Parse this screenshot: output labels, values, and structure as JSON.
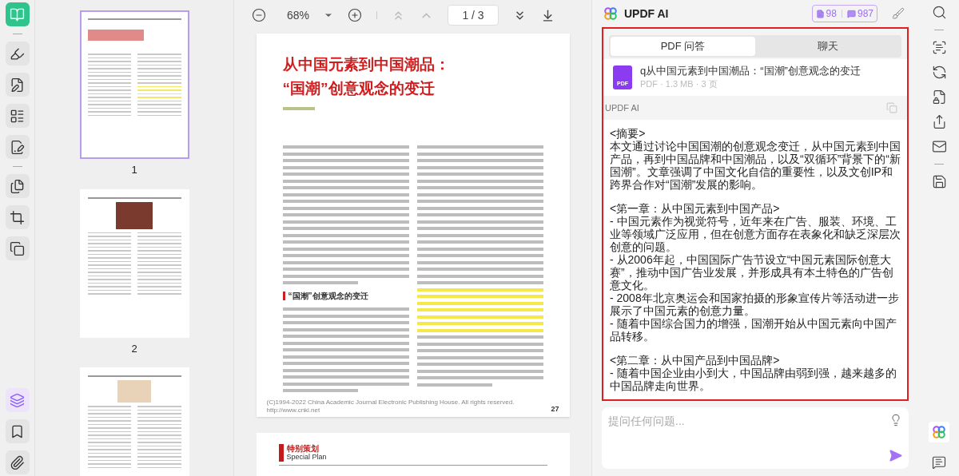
{
  "left_toolbar": {
    "top": [
      {
        "kind": "reader",
        "selected": true
      }
    ],
    "tools": [
      {
        "kind": "comment",
        "selected": false
      },
      {
        "kind": "edit",
        "selected": false
      },
      {
        "kind": "organize",
        "selected": false
      },
      {
        "kind": "fill",
        "selected": false
      }
    ],
    "pages": [
      {
        "kind": "pages",
        "selected": false
      },
      {
        "kind": "crop",
        "selected": false
      },
      {
        "kind": "compress",
        "selected": false
      }
    ],
    "bottom": [
      {
        "kind": "layers",
        "selected": true
      },
      {
        "kind": "bookmark",
        "selected": false
      },
      {
        "kind": "attachment",
        "selected": false
      }
    ]
  },
  "thumbnails": [
    {
      "label": "1",
      "selected": true,
      "kind": "title"
    },
    {
      "label": "2",
      "selected": false,
      "kind": "photo"
    },
    {
      "selected": false,
      "kind": "illustration"
    }
  ],
  "viewer_toolbar": {
    "zoom": "68%",
    "page": "1 / 3",
    "first_disabled": true,
    "prev_disabled": true
  },
  "document": {
    "title_lines": [
      "从中国元素到中国潮品：",
      "“国潮”创意观念的变迁"
    ],
    "section_heading": "“国潮”创意观念的变迁",
    "footer": "(C)1994-2022 China Academic Journal Electronic Publishing House. All rights reserved.    http://www.cnki.net",
    "page_number": "27",
    "next_page_header": "特别策划",
    "next_page_subheader": "Special Plan"
  },
  "ai_panel": {
    "title": "UPDF AI",
    "credits": [
      {
        "kind": "document",
        "value": "98"
      },
      {
        "kind": "chat",
        "value": "987"
      }
    ],
    "tabs": [
      {
        "label": "PDF 问答",
        "selected": true
      },
      {
        "label": "聊天",
        "selected": false
      }
    ],
    "file": {
      "name": "q从中国元素到中国潮品：“国潮”创意观念的变迁",
      "meta": "PDF · 1.3 MB · 3 页",
      "icon_text": "PDF"
    },
    "answer_label": "UPDF AI",
    "answer": [
      {
        "heading": "<摘要>",
        "lines": [
          "本文通过讨论中国国潮的创意观念变迁，从中国元素到中国产品，再到中国品牌和中国潮品，以及“双循环”背景下的“新国潮”。文章强调了中国文化自信的重要性，以及文创IP和跨界合作对“国潮”发展的影响。"
        ]
      },
      {
        "heading": "<第一章：从中国元素到中国产品>",
        "lines": [
          "- 中国元素作为视觉符号，近年来在广告、服装、环境、工业等领域广泛应用，但在创意方面存在表象化和缺乏深层次创意的问题。",
          "- 从2006年起，中国国际广告节设立“中国元素国际创意大赛”，推动中国广告业发展，并形成具有本土特色的广告创意文化。",
          "- 2008年北京奥运会和国家拍摄的形象宣传片等活动进一步展示了中国元素的创意力量。",
          "- 随着中国综合国力的增强，国潮开始从中国元素向中国产品转移。"
        ]
      },
      {
        "heading": "<第二章：从中国产品到中国品牌>",
        "lines": [
          "- 随着中国企业由小到大，中国品牌由弱到强，越来越多的中国品牌走向世界。"
        ]
      }
    ],
    "input": {
      "placeholder": "提问任何问题..."
    }
  },
  "right_toolbar": {
    "top": [
      {
        "kind": "search"
      },
      {
        "kind": "divider"
      },
      {
        "kind": "ocr"
      },
      {
        "kind": "convert"
      },
      {
        "kind": "protect"
      },
      {
        "kind": "share"
      },
      {
        "kind": "mail"
      },
      {
        "kind": "divider"
      },
      {
        "kind": "save"
      }
    ],
    "bottom": [
      {
        "kind": "ai",
        "selected": true
      },
      {
        "kind": "comment",
        "selected": false
      }
    ]
  }
}
